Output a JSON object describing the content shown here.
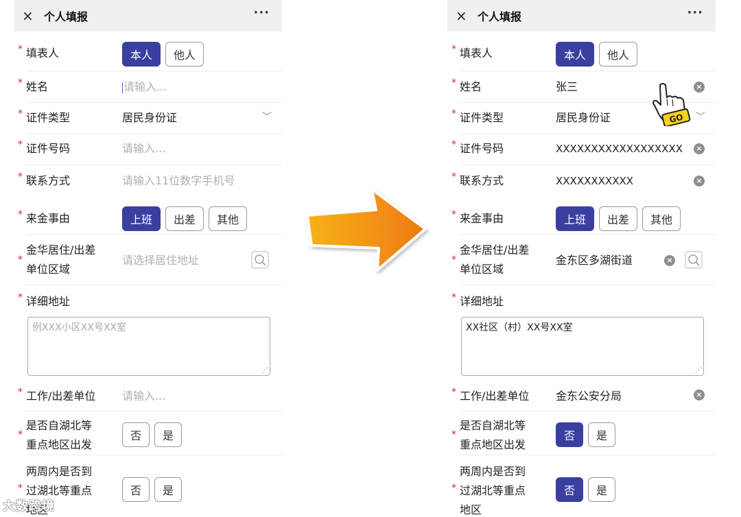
{
  "left": {
    "header": {
      "title": "个人填报",
      "close_icon": "×",
      "more_icon": "···"
    },
    "filler": {
      "label": "填表人",
      "options": [
        "本人",
        "他人"
      ],
      "selected": 0
    },
    "name": {
      "label": "姓名",
      "placeholder": "请输入..."
    },
    "id_type": {
      "label": "证件类型",
      "value": "居民身份证"
    },
    "id_number": {
      "label": "证件号码",
      "placeholder": "请输入..."
    },
    "contact": {
      "label": "联系方式",
      "placeholder": "请输入11位数字手机号"
    },
    "reason": {
      "label": "来金事由",
      "options": [
        "上班",
        "出差",
        "其他"
      ],
      "selected": 0
    },
    "area": {
      "label_line1": "金华居住/出差",
      "label_line2": "单位区域",
      "placeholder": "请选择居住地址"
    },
    "address": {
      "label": "详细地址",
      "placeholder": "例XXX小区XX号XX室"
    },
    "employer": {
      "label": "工作/出差单位",
      "placeholder": "请输入..."
    },
    "from_hubei": {
      "label_line1": "是否自湖北等",
      "label_line2": "重点地区出发",
      "options": [
        "否",
        "是"
      ],
      "selected": -1
    },
    "been_hubei": {
      "label_line1": "两周内是否到",
      "label_line2": "过湖北等重点",
      "label_line3": "地区",
      "options": [
        "否",
        "是"
      ],
      "selected": -1
    }
  },
  "right": {
    "header": {
      "title": "个人填报",
      "close_icon": "×",
      "more_icon": "···"
    },
    "filler": {
      "label": "填表人",
      "options": [
        "本人",
        "他人"
      ],
      "selected": 0
    },
    "name": {
      "label": "姓名",
      "value": "张三"
    },
    "id_type": {
      "label": "证件类型",
      "value": "居民身份证"
    },
    "id_number": {
      "label": "证件号码",
      "value": "XXXXXXXXXXXXXXXXXX"
    },
    "contact": {
      "label": "联系方式",
      "value": "XXXXXXXXXXX"
    },
    "reason": {
      "label": "来金事由",
      "options": [
        "上班",
        "出差",
        "其他"
      ],
      "selected": 0
    },
    "area": {
      "label_line1": "金华居住/出差",
      "label_line2": "单位区域",
      "value": "金东区多湖街道"
    },
    "address": {
      "label": "详细地址",
      "value": "XX社区（村）XX号XX室"
    },
    "employer": {
      "label": "工作/出差单位",
      "value": "金东公安分局"
    },
    "from_hubei": {
      "label_line1": "是否自湖北等",
      "label_line2": "重点地区出发",
      "options": [
        "否",
        "是"
      ],
      "selected": 0
    },
    "been_hubei": {
      "label_line1": "两周内是否到",
      "label_line2": "过湖北等重点",
      "label_line3": "地区",
      "options": [
        "否",
        "是"
      ],
      "selected": 0
    }
  },
  "decor": {
    "hand_badge": "GO",
    "watermark": "大数跨境"
  },
  "colors": {
    "accent": "#3a3fa0",
    "required": "#e02020",
    "arrow_start": "#f6b21a",
    "arrow_end": "#ee7a10"
  }
}
